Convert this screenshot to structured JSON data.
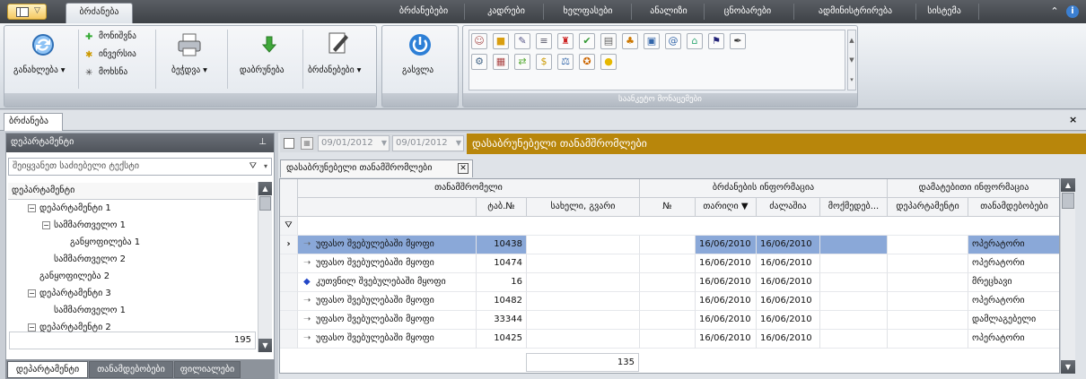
{
  "title_bar": {
    "tabs": [
      "ბრძანება",
      "ბრძანებები",
      "კადრები",
      "ხელფასები",
      "ანალიზი",
      "ცნობარები",
      "ადმინისტრირება",
      "სისტემა"
    ],
    "active_tab": "ბრძანება"
  },
  "ribbon": {
    "refresh_label": "განახლება ▾",
    "select_label": "მონიშვნა",
    "invert_label": "ინვერსია",
    "remove_label": "მოხსნა",
    "print_label": "ბეჭდვა ▾",
    "return_label": "დაბრუნება",
    "orders_label": "ბრძანებები ▾",
    "exit_label": "გასვლა",
    "gallery_footer": "საანკეტო მონაცემები",
    "gallery_icons": [
      "person",
      "folder",
      "tools",
      "document",
      "award",
      "checklist",
      "paper",
      "people",
      "card",
      "at",
      "home",
      "flag",
      "pen",
      "gear",
      "calendar",
      "arrows",
      "money",
      "scale",
      "medal",
      "coin"
    ]
  },
  "doc_tab": "ბრძანება",
  "left": {
    "header": "დეპარტამენტი",
    "search_placeholder": "შეიყვანეთ საძიებელი ტექსტი",
    "tree_header": "დეპარტამენტი",
    "tree": [
      {
        "label": "დეპარტამენტი 1",
        "level": 1,
        "box": "−"
      },
      {
        "label": "სამმართველო 1",
        "level": 2,
        "box": "−"
      },
      {
        "label": "განყოფილება 1",
        "level": 3,
        "box": ""
      },
      {
        "label": "სამმართველო 2",
        "level": 2,
        "box": ""
      },
      {
        "label": "განყოფილება 2",
        "level": 1,
        "box": ""
      },
      {
        "label": "დეპარტამენტი 3",
        "level": 1,
        "box": "−"
      },
      {
        "label": "სამმართველო 1",
        "level": 2,
        "box": ""
      },
      {
        "label": "დეპარტამენტი 2",
        "level": 1,
        "box": "−"
      }
    ],
    "count": "195",
    "bottom_tabs": [
      "დეპარტამენტი",
      "თანამდებობები",
      "ფილიალები"
    ]
  },
  "right": {
    "date_from": "09/01/2012",
    "date_to": "09/01/2012",
    "banner": "დასაბრუნებელი თანამშრომლები",
    "subtab": "დასაბრუნებელი თანამშრომლები",
    "band_headers": [
      "თანამშრომელი",
      "ბრძანების ინფორმაცია",
      "დამატებითი ინფორმაცია"
    ],
    "columns": [
      "ტაბ.№",
      "სახელი, გვარი",
      "№",
      "თარიღი ▼",
      "ძალაშია",
      "მოქმედებ...",
      "დეპარტამენტი",
      "თანამდებობები"
    ],
    "rows": [
      {
        "status": "უფასო შვებულებაში მყოფი",
        "tab": "10438",
        "date": "16/06/2010",
        "valid": "16/06/2010",
        "position": "ოპერატორი",
        "marker": "›"
      },
      {
        "status": "უფასო შვებულებაში მყოფი",
        "tab": "10474",
        "date": "16/06/2010",
        "valid": "16/06/2010",
        "position": "ოპერატორი",
        "marker": ""
      },
      {
        "status": "კუთვნილ შვებულებაში მყოფი",
        "tab": "16",
        "date": "16/06/2010",
        "valid": "16/06/2010",
        "position": "მრეცხავი",
        "marker": ""
      },
      {
        "status": "უფასო შვებულებაში მყოფი",
        "tab": "10482",
        "date": "16/06/2010",
        "valid": "16/06/2010",
        "position": "ოპერატორი",
        "marker": ""
      },
      {
        "status": "უფასო შვებულებაში მყოფი",
        "tab": "33344",
        "date": "16/06/2010",
        "valid": "16/06/2010",
        "position": "დამლაგებელი",
        "marker": ""
      },
      {
        "status": "უფასო შვებულებაში მყოფი",
        "tab": "10425",
        "date": "16/06/2010",
        "valid": "16/06/2010",
        "position": "ოპერატორი",
        "marker": ""
      }
    ],
    "footer_count": "135"
  },
  "colors": {
    "banner": "#b8860b",
    "selection": "#8aa8d8",
    "titlebar": "#3d4146"
  }
}
